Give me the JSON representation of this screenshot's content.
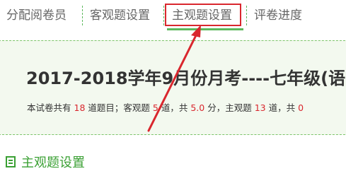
{
  "tabs": [
    {
      "label": "分配阅卷员"
    },
    {
      "label": "客观题设置"
    },
    {
      "label": "主观题设置",
      "active": true
    },
    {
      "label": "评卷进度"
    }
  ],
  "exam": {
    "title": "2017-2018学年9月份月考----七年级(语",
    "summary": {
      "prefix": "本试卷共有",
      "total_questions": "18",
      "part1": "道题目；客观题",
      "objective_count": "5",
      "part2": "道，共",
      "objective_score": "5.0",
      "part3": "分，主观题",
      "subjective_count": "13",
      "part4": "道，共",
      "trailing": "0"
    }
  },
  "section": {
    "title": "主观题设置",
    "icon": "list-icon"
  },
  "colors": {
    "highlight_box": "#d9272e",
    "accent_green": "#3aa033",
    "panel_bg": "#f3f9ef",
    "number_red": "#d9272e"
  }
}
